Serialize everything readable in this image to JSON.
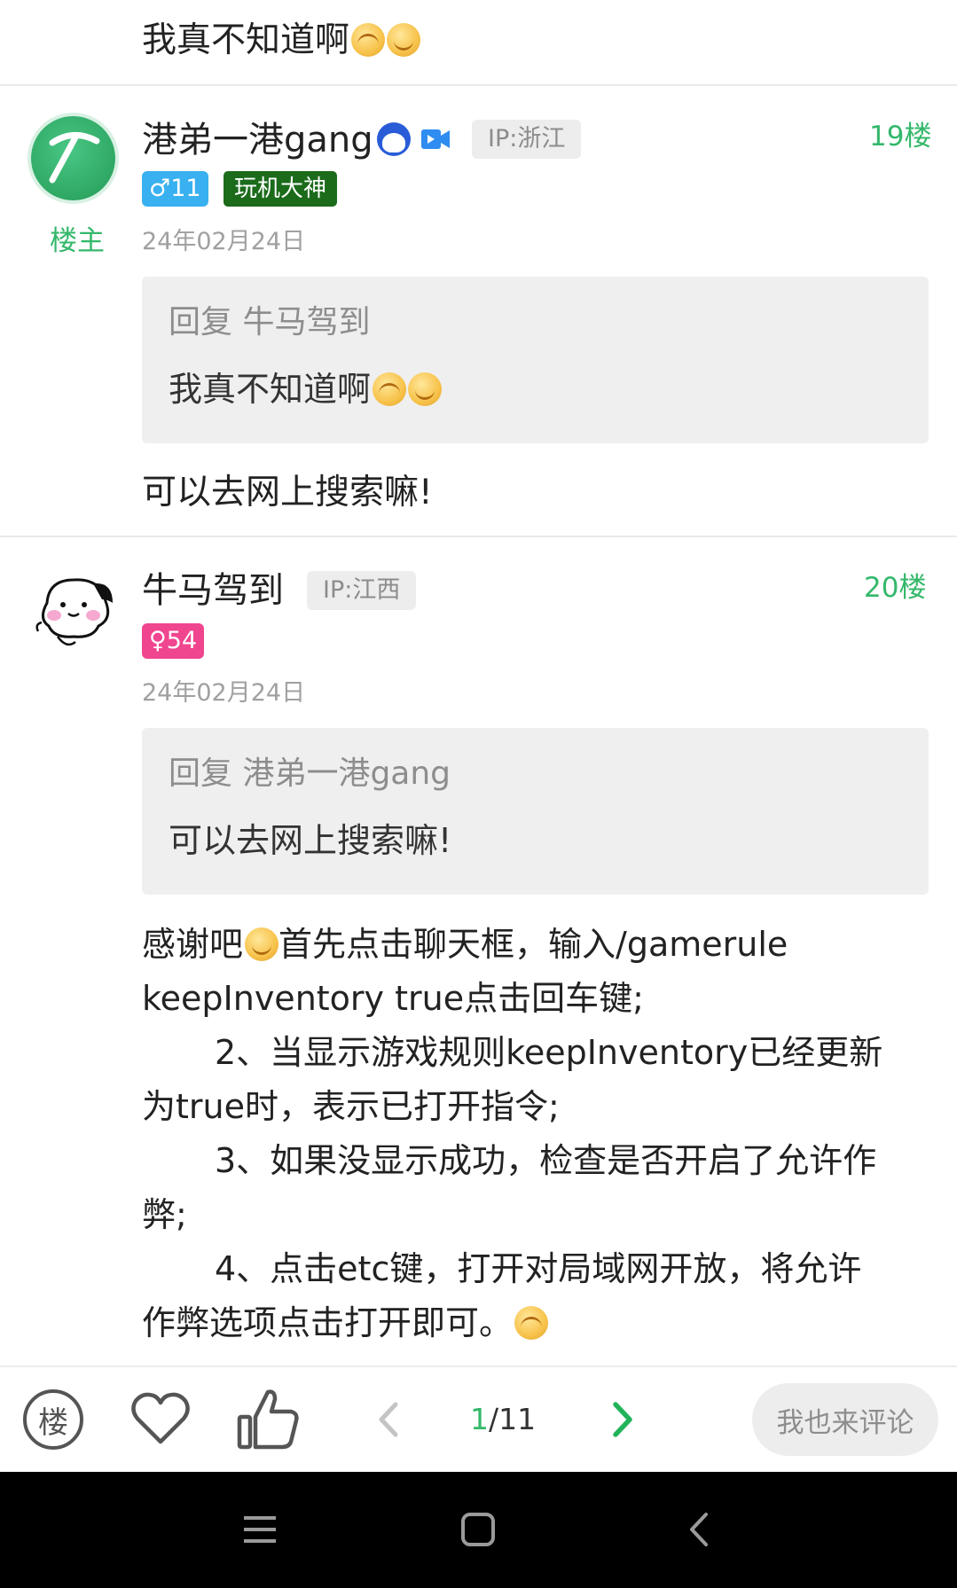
{
  "top_snippet": {
    "text": "我真不知道啊"
  },
  "posts": [
    {
      "username": "港弟一港gang",
      "ip": "IP:浙江",
      "floor": "19楼",
      "gender_level": "♂11",
      "title_badge": "玩机大神",
      "owner_tag": "楼主",
      "date": "24年02月24日",
      "quote_header": "回复 牛马驾到",
      "quote_body": "我真不知道啊",
      "content": "可以去网上搜索嘛!"
    },
    {
      "username": "牛马驾到",
      "ip": "IP:江西",
      "floor": "20楼",
      "gender_level": "♀54",
      "date": "24年02月24日",
      "quote_header": "回复 港弟一港gang",
      "quote_body": "可以去网上搜索嘛!",
      "content_lines": [
        "感谢吧",
        "首先点击聊天框，输入/gamerule",
        "keepInventory true点击回车键;",
        "2、当显示游戏规则keepInventory已经更新",
        "为true时，表示已打开指令;",
        "3、如果没显示成功，检查是否开启了允许作",
        "弊;",
        "4、点击etc键，打开对局域网开放，将允许",
        "作弊选项点击打开即可。"
      ]
    }
  ],
  "bottom_bar": {
    "floor_button": "楼",
    "page_current": "1",
    "page_total": "/11",
    "comment_placeholder": "我也来评论"
  },
  "colors": {
    "accent": "#34b86b",
    "male": "#39b0f0",
    "female": "#f0458f"
  }
}
